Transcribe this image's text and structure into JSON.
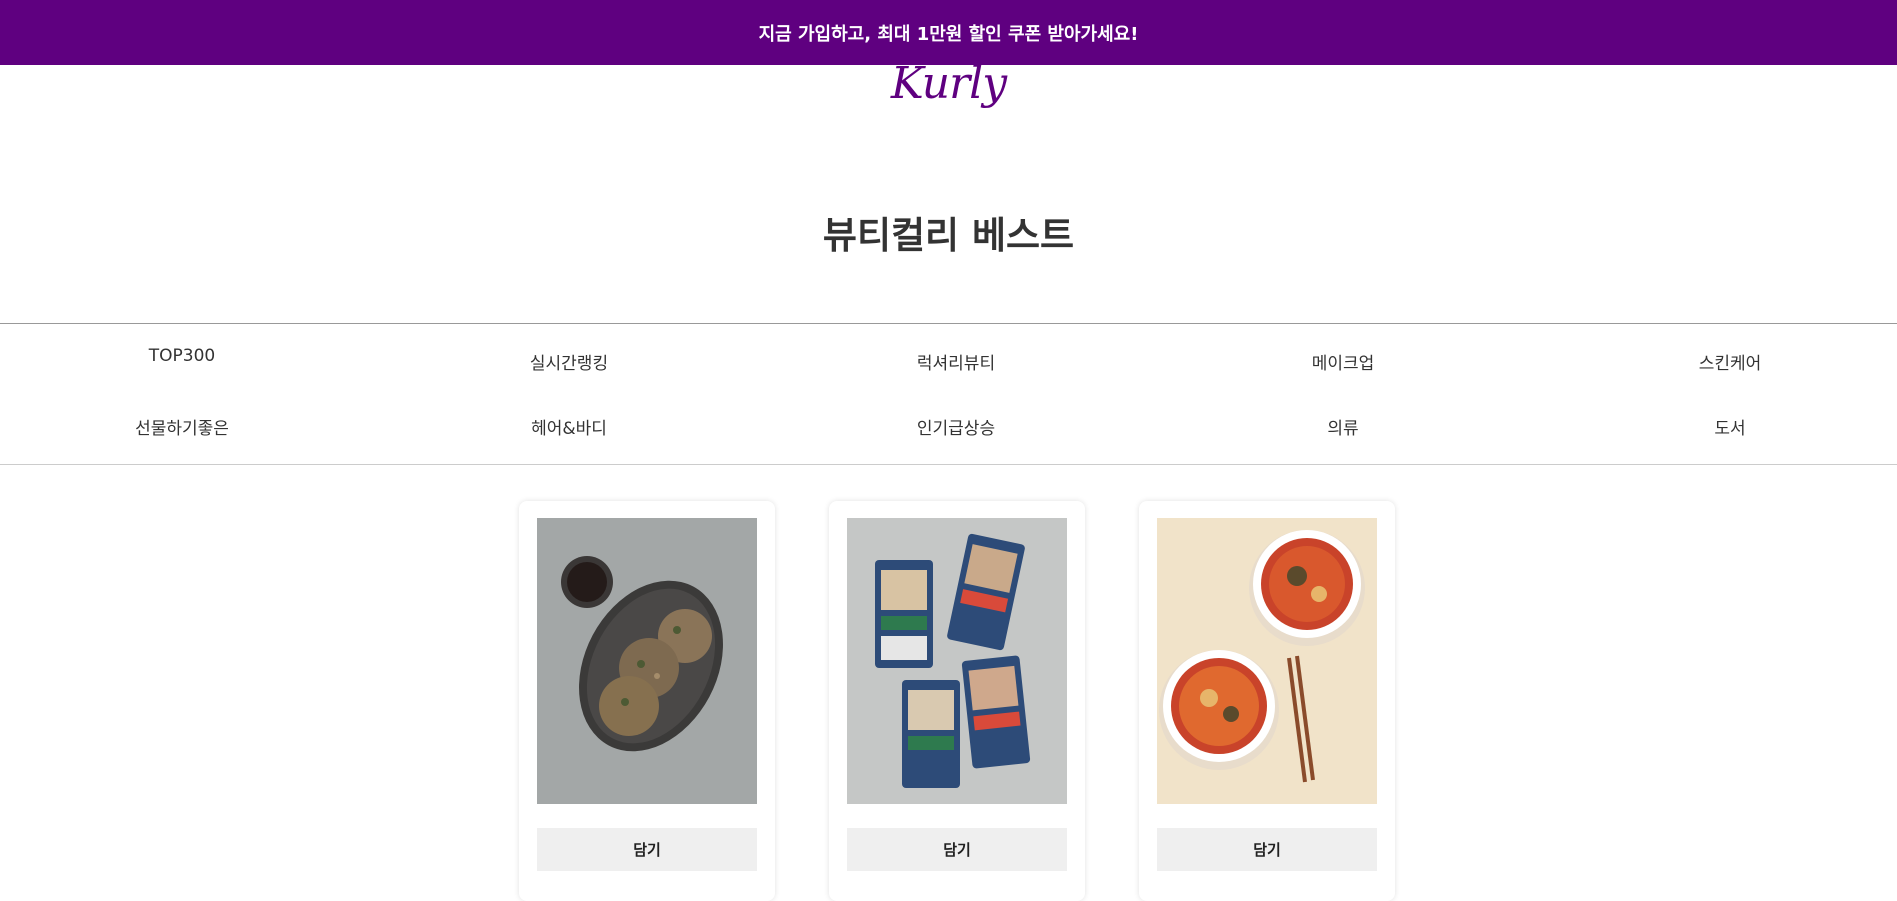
{
  "banner": {
    "text": "지금 가입하고, 최대 1만원 할인 쿠폰 받아가세요!",
    "color": "#5f0080"
  },
  "logo": {
    "text": "Kurly"
  },
  "page": {
    "title": "뷰티컬리 베스트"
  },
  "categories": [
    "TOP300",
    "실시간랭킹",
    "럭셔리뷰티",
    "메이크업",
    "스킨케어",
    "선물하기좋은",
    "헤어&바디",
    "인기급상승",
    "의류",
    "도서"
  ],
  "products": [
    {
      "image": "meat-patties-on-oval-plate-image",
      "button_label": "담기"
    },
    {
      "image": "packaged-grilled-fish-image",
      "button_label": "담기"
    },
    {
      "image": "spicy-noodle-soup-bowls-image",
      "button_label": "담기"
    }
  ]
}
